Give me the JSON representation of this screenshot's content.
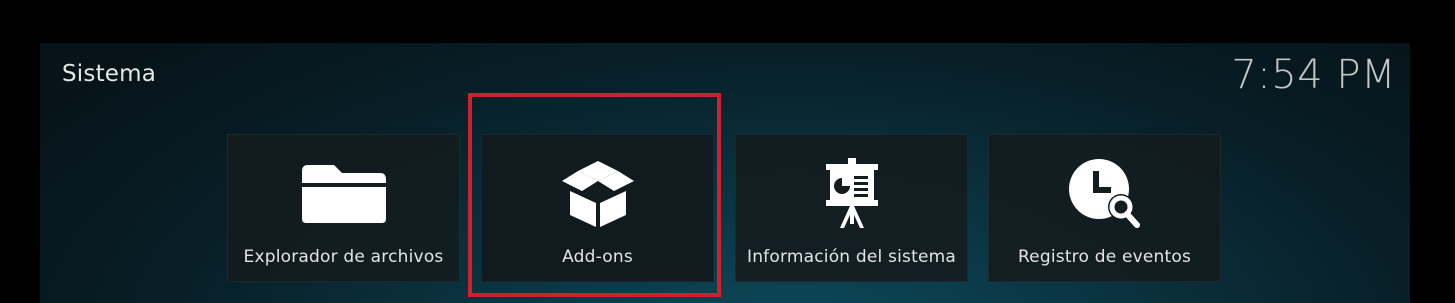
{
  "header": {
    "title": "Sistema",
    "clock": "7:54 PM"
  },
  "tiles": [
    {
      "label": "Explorador de archivos",
      "icon": "folder-icon"
    },
    {
      "label": "Add-ons",
      "icon": "open-box-icon"
    },
    {
      "label": "Información del sistema",
      "icon": "presentation-board-icon"
    },
    {
      "label": "Registro de eventos",
      "icon": "clock-search-icon"
    }
  ],
  "focused_tile": "Add-ons",
  "colors": {
    "highlight": "#d0202e",
    "text": "#e4e4e4"
  }
}
